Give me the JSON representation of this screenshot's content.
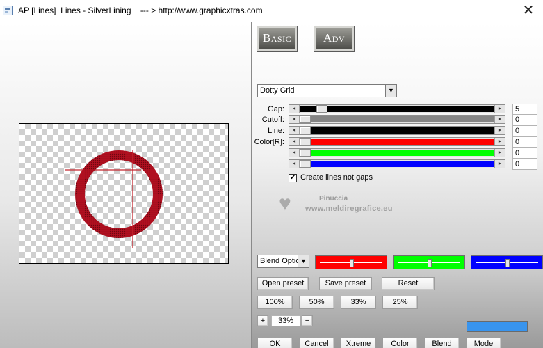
{
  "window": {
    "title": "AP [Lines]  Lines - SilverLining    --- > http://www.graphicxtras.com",
    "close_glyph": "✕"
  },
  "canvas": {
    "ring_color": "#b01020",
    "line_color": "#c2262e"
  },
  "tabs": {
    "basic_label": "Basic",
    "adv_label": "Adv"
  },
  "mode_select": {
    "value": "Dotty Grid"
  },
  "sliders": [
    {
      "label": "Gap:",
      "value": "5",
      "level": 0.09,
      "fill": "#000000"
    },
    {
      "label": "Cutoff:",
      "value": "0",
      "level": 0.0,
      "fill": "#858585"
    },
    {
      "label": "Line:",
      "value": "0",
      "level": 0.0,
      "fill": "#000000"
    },
    {
      "label": "Color[R]:",
      "value": "0",
      "level": 0.0,
      "fill": "#ff0000"
    },
    {
      "label": "",
      "value": "0",
      "level": 0.0,
      "fill": "#00ff00"
    },
    {
      "label": "",
      "value": "0",
      "level": 0.0,
      "fill": "#0000ff"
    }
  ],
  "create_lines": {
    "checked_glyph": "✔",
    "label": "Create lines not gaps"
  },
  "watermark": {
    "name": "Pinuccia",
    "url": "www.meldiregrafice.eu"
  },
  "blend": {
    "select_value": "Blend Optio",
    "mini_sliders": [
      {
        "color": "#ff0000",
        "level": 0.5
      },
      {
        "color": "#00ff00",
        "level": 0.5
      },
      {
        "color": "#0000ff",
        "level": 0.5
      }
    ]
  },
  "preset_buttons": {
    "open": "Open preset",
    "save": "Save preset",
    "reset": "Reset"
  },
  "zoom_buttons": [
    "100%",
    "50%",
    "33%",
    "25%"
  ],
  "zoom_control": {
    "plus": "+",
    "value": "33%",
    "minus": "−"
  },
  "swatch_color": "#3894ee",
  "bottom_buttons": [
    "OK",
    "Cancel",
    "Xtreme",
    "Color",
    "Blend",
    "Mode"
  ]
}
